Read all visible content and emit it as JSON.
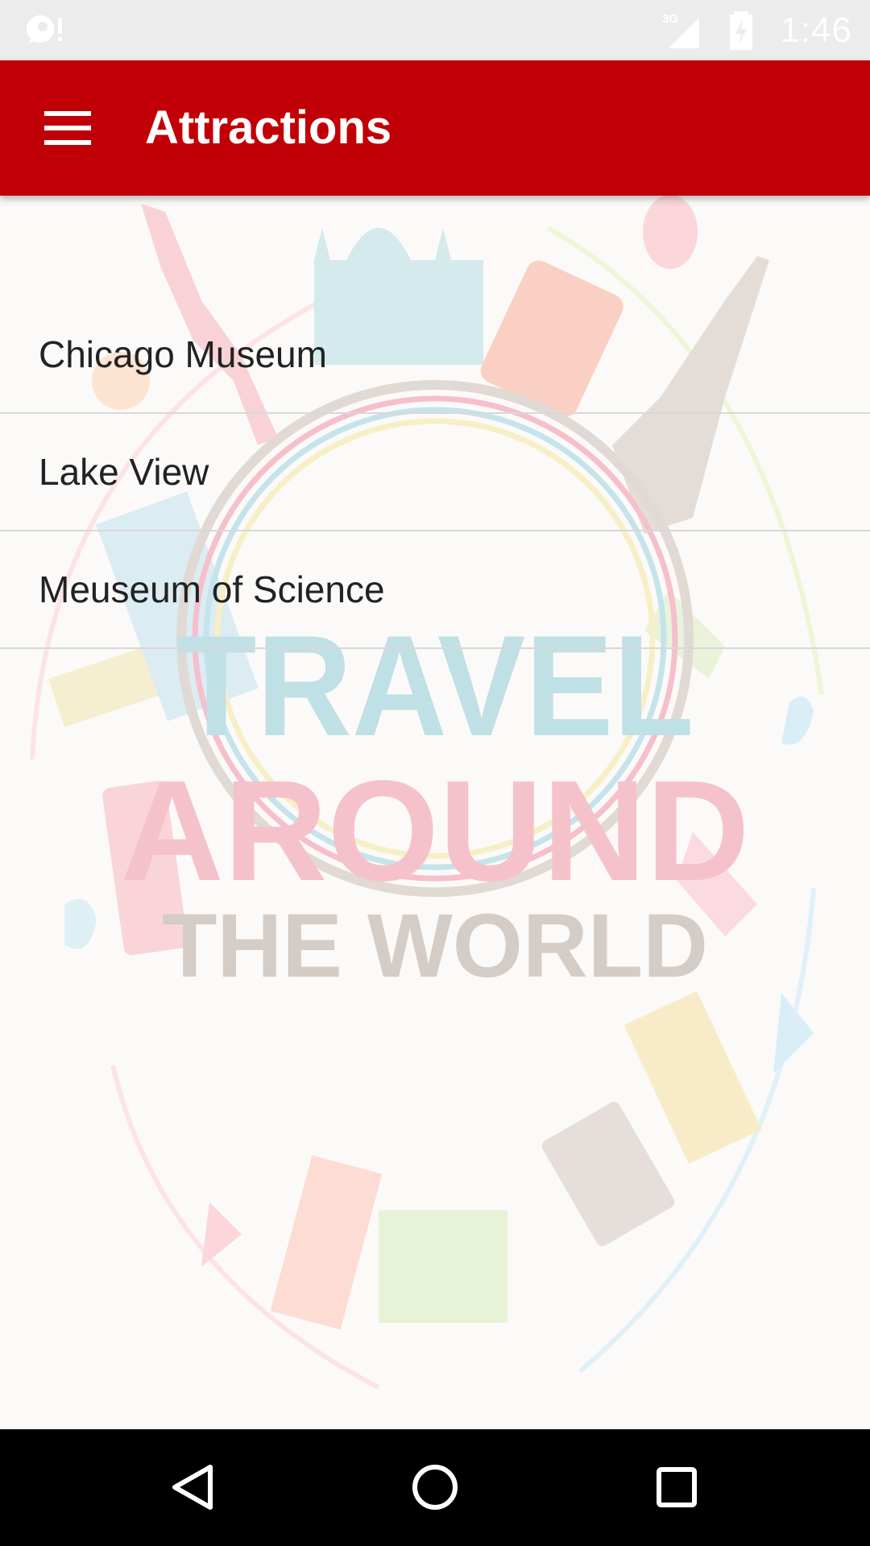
{
  "status_bar": {
    "time": "1:46",
    "network": "3G",
    "icons": [
      "notification-icon",
      "signal-3g-icon",
      "battery-charging-icon"
    ]
  },
  "app_bar": {
    "title": "Attractions",
    "menu_icon": "hamburger-menu-icon",
    "color": "#c00006"
  },
  "attractions": [
    {
      "label": "Chicago Museum"
    },
    {
      "label": "Lake View"
    },
    {
      "label": "Meuseum of Science"
    }
  ],
  "background": {
    "line1": "TRAVEL",
    "line2": "AROUND",
    "line3": "THE WORLD",
    "colors": {
      "travel": "#a9d5dc",
      "around": "#f2a7b4",
      "world": "#bfb7ae"
    }
  },
  "nav_bar": {
    "icons": [
      "back-icon",
      "home-icon",
      "recents-icon"
    ]
  }
}
